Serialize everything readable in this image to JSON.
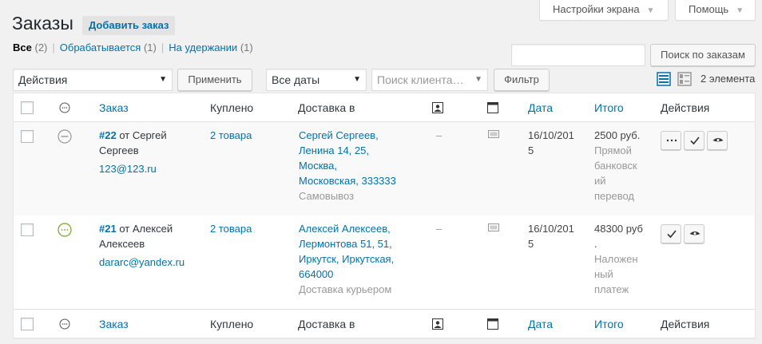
{
  "screen_options": {
    "screen_settings": "Настройки экрана",
    "help": "Помощь"
  },
  "header": {
    "title": "Заказы",
    "add_order": "Добавить заказ"
  },
  "filters_views": {
    "all_label": "Все",
    "all_count": "(2)",
    "processing_label": "Обрабатывается",
    "processing_count": "(1)",
    "onhold_label": "На удержании",
    "onhold_count": "(1)"
  },
  "search": {
    "value": "",
    "button": "Поиск по заказам"
  },
  "tablenav": {
    "bulk_actions": "Действия",
    "apply": "Применить",
    "dates": "Все даты",
    "customer_placeholder": "Поиск клиента…",
    "filter": "Фильтр",
    "displaying": "2 элемента"
  },
  "columns": {
    "order": "Заказ",
    "purchased": "Куплено",
    "ship_to": "Доставка в",
    "date": "Дата",
    "total": "Итого",
    "actions": "Действия"
  },
  "orders": [
    {
      "number": "#22",
      "from": "от Сергей",
      "from2": "Сергеев",
      "email": "123@123.ru",
      "items": "2 товара",
      "ship_lines": [
        "Сергей Сергеев,",
        "Ленина 14, 25,",
        "Москва,",
        "Московская, 333333"
      ],
      "ship_method": "Самовывоз",
      "dash": "–",
      "date_lines": [
        "16/10/201",
        "5"
      ],
      "total": "2500 руб.",
      "pay_lines": [
        "Прямой",
        "банковск",
        "ий",
        "перевод"
      ],
      "status_color": "#999999"
    },
    {
      "number": "#21",
      "from": "от Алексей",
      "from2": "Алексеев",
      "email": "dararc@yandex.ru",
      "items": "2 товара",
      "ship_lines": [
        "Алексей Алексеев,",
        "Лермонтова 51, 51,",
        "Иркутск, Иркутская,",
        "664000"
      ],
      "ship_method": "Доставка курьером",
      "dash": "–",
      "date_lines": [
        "16/10/201",
        "5"
      ],
      "total_lines": [
        "48300 руб",
        "."
      ],
      "pay_lines": [
        "Наложен",
        "ный",
        "платеж"
      ],
      "status_color": "#73a724"
    }
  ]
}
